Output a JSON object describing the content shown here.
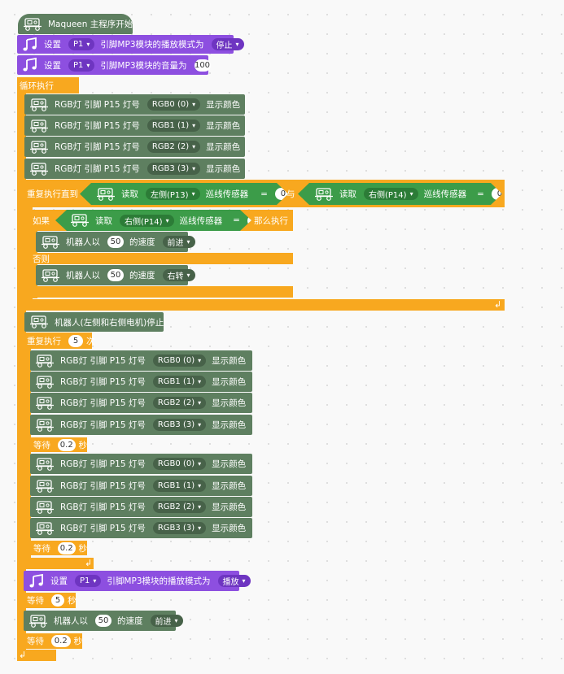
{
  "hat": {
    "label": "Maqueen 主程序开始"
  },
  "mp3": {
    "set": "设置",
    "pin": "P1",
    "mode_text": "引脚MP3模块的播放模式为",
    "mode_stop": "停止",
    "mode_play": "播放",
    "volume_text": "引脚MP3模块的音量为",
    "volume": "100"
  },
  "loop": {
    "label": "循环执行"
  },
  "rgb": {
    "prefix": "RGB灯 引脚 P15 灯号",
    "show": "显示颜色",
    "leds": [
      "RGB0 (0)",
      "RGB1 (1)",
      "RGB2 (2)",
      "RGB3 (3)"
    ],
    "colors_first": [
      "#fb8600",
      "#ffff00",
      "#00ff00",
      "#0000e0"
    ],
    "color_red": "#ff0000",
    "color_black": "#000000"
  },
  "repeat_until": {
    "label": "重复执行直到",
    "read": "读取",
    "left": "左侧(P13)",
    "right": "右侧(P14)",
    "sensor": "巡线传感器",
    "eq": "=",
    "zero": "0",
    "and": "与"
  },
  "ifelse": {
    "if": "如果",
    "then": "那么执行",
    "else": "否则"
  },
  "move": {
    "prefix": "机器人以",
    "speed": "50",
    "speed_text": "的速度",
    "forward": "前进",
    "right_turn": "右转"
  },
  "stop": {
    "label": "机器人(左侧和右侧电机)停止"
  },
  "repeat": {
    "label": "重复执行",
    "times": "5",
    "unit": "次"
  },
  "wait": {
    "label": "等待",
    "short": "0.2",
    "long": "5",
    "unit": "秒"
  },
  "icons": {
    "robot": "robot-icon",
    "music": "music-note-icon",
    "loop_return": "↲"
  }
}
